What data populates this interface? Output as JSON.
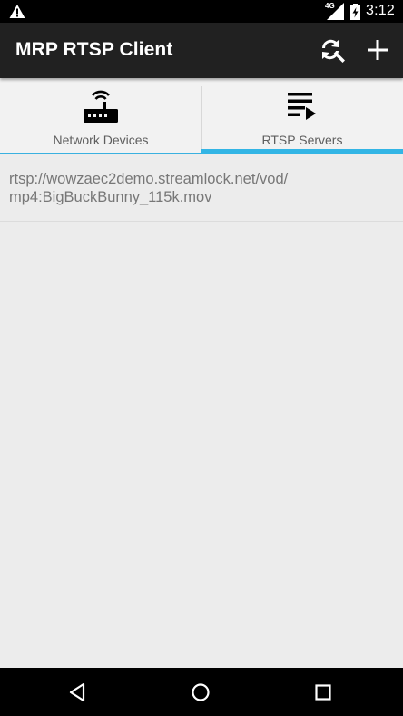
{
  "status_bar": {
    "network_type": "4G",
    "time": "3:12",
    "icons": [
      "warning-icon",
      "signal-icon",
      "battery-charging-icon"
    ]
  },
  "app_bar": {
    "title": "MRP RTSP Client",
    "actions": [
      {
        "icon": "search-refresh-icon"
      },
      {
        "icon": "add-icon"
      }
    ]
  },
  "tabs": [
    {
      "label": "Network Devices",
      "icon": "router-icon",
      "selected": false
    },
    {
      "label": "RTSP Servers",
      "icon": "playlist-play-icon",
      "selected": true
    }
  ],
  "servers": [
    {
      "url": "rtsp://wowzaec2demo.streamlock.net/vod/\nmp4:BigBuckBunny_115k.mov"
    }
  ],
  "colors": {
    "app_bar": "#212121",
    "tab_indicator": "#33b5e5",
    "background": "#ececec",
    "list_text": "#777777"
  },
  "nav_bar": {
    "buttons": [
      "back-icon",
      "home-icon",
      "recents-icon"
    ]
  }
}
